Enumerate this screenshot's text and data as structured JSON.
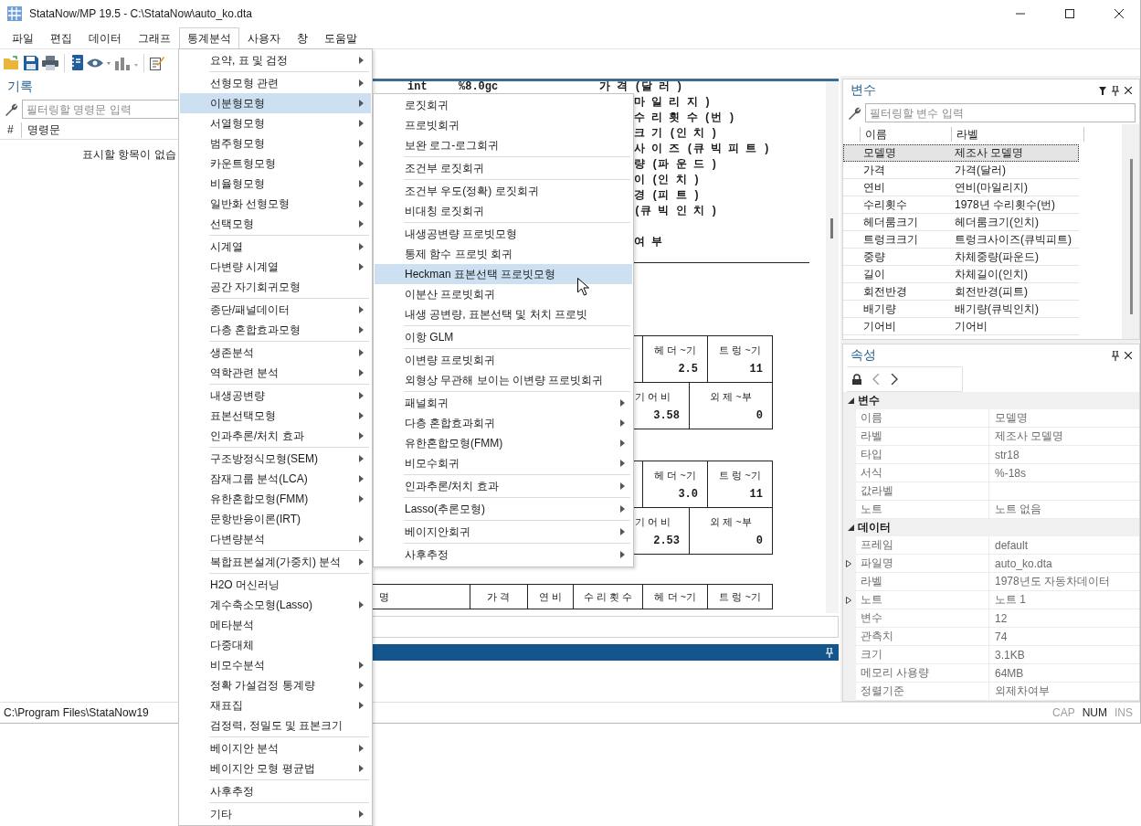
{
  "window": {
    "title": "StataNow/MP 19.5 - C:\\StataNow\\auto_ko.dta"
  },
  "menubar": [
    {
      "label": "파일",
      "selected": false
    },
    {
      "label": "편집",
      "selected": false
    },
    {
      "label": "데이터",
      "selected": false
    },
    {
      "label": "그래프",
      "selected": false
    },
    {
      "label": "통계분석",
      "selected": true
    },
    {
      "label": "사용자",
      "selected": false
    },
    {
      "label": "창",
      "selected": false
    },
    {
      "label": "도움말",
      "selected": false
    }
  ],
  "history": {
    "title": "기록",
    "filter": {
      "placeholder": "필터링할 명령문 입력"
    },
    "columns": [
      "#",
      "명령문"
    ],
    "empty_text": "표시할 항목이 없습"
  },
  "results": {
    "describe_first": [
      "int",
      "%8.0gc",
      "가 격 (달 러 )"
    ],
    "describe_lines": [
      "마 일 리 지 )",
      "수 리 횟 수 (번 )",
      "크 기 (인 치 )",
      "사 이 즈 (큐 빅 피 트 )",
      "량 (파 운 드 )",
      "이 (인 치 )",
      "경 (피 트 )",
      "(큐 빅 인 치 )",
      "여 부"
    ],
    "tables": [
      {
        "rows": [
          [
            {
              "header": "헤 더 ~기",
              "value": "2.5"
            },
            {
              "header": "트 렁 ~기",
              "value": "11"
            }
          ],
          [
            {
              "header": "기 어 비",
              "value": "3.58"
            },
            {
              "header": "외 제 ~부",
              "value": "0"
            }
          ]
        ]
      },
      {
        "rows": [
          [
            {
              "header": "헤 더 ~기",
              "value": "3.0"
            },
            {
              "header": "트 렁 ~기",
              "value": "11"
            }
          ],
          [
            {
              "header": "기 어 비",
              "value": "2.53"
            },
            {
              "header": "외 제 ~부",
              "value": "0"
            }
          ]
        ]
      }
    ],
    "list_header": [
      "명",
      "가 격",
      "연 비",
      "수 리 횟 수",
      "헤 더 ~기",
      "트 렁 ~기"
    ]
  },
  "variables": {
    "title": "변수",
    "filter": {
      "placeholder": "필터링할 변수 입력"
    },
    "columns": [
      "이름",
      "라벨"
    ],
    "rows": [
      {
        "name": "모델명",
        "label": "제조사 모델명",
        "selected": true
      },
      {
        "name": "가격",
        "label": "가격(달러)",
        "selected": false
      },
      {
        "name": "연비",
        "label": "연비(마일리지)",
        "selected": false
      },
      {
        "name": "수리횟수",
        "label": "1978년 수리횟수(번)",
        "selected": false
      },
      {
        "name": "헤더룸크기",
        "label": "헤더룸크기(인치)",
        "selected": false
      },
      {
        "name": "트렁크크기",
        "label": "트렁크사이즈(큐빅피트)",
        "selected": false
      },
      {
        "name": "중량",
        "label": "차체중량(파운드)",
        "selected": false
      },
      {
        "name": "길이",
        "label": "차체길이(인치)",
        "selected": false
      },
      {
        "name": "회전반경",
        "label": "회전반경(피트)",
        "selected": false
      },
      {
        "name": "배기량",
        "label": "배기량(큐빅인치)",
        "selected": false
      },
      {
        "name": "기어비",
        "label": "기어비",
        "selected": false
      }
    ]
  },
  "properties": {
    "title": "속성",
    "groups": [
      {
        "name": "변수",
        "expanded": true,
        "rows": [
          {
            "key": "이름",
            "value": "모델명",
            "expandable": false
          },
          {
            "key": "라벨",
            "value": "제조사 모델명",
            "expandable": false
          },
          {
            "key": "타입",
            "value": "str18",
            "expandable": false
          },
          {
            "key": "서식",
            "value": "%-18s",
            "expandable": false
          },
          {
            "key": "값라벨",
            "expandable": false
          },
          {
            "key": "노트",
            "value": "노트 없음",
            "expandable": false
          }
        ]
      },
      {
        "name": "데이터",
        "expanded": true,
        "rows": [
          {
            "key": "프레임",
            "value": "default",
            "expandable": false
          },
          {
            "key": "파일명",
            "value": "auto_ko.dta",
            "expandable": true
          },
          {
            "key": "라벨",
            "value": "1978년도 자동차데이터",
            "expandable": false
          },
          {
            "key": "노트",
            "value": "노트 1",
            "expandable": true
          },
          {
            "key": "변수",
            "value": "12",
            "expandable": false
          },
          {
            "key": "관측치",
            "value": "74",
            "expandable": false
          },
          {
            "key": "크기",
            "value": "3.1KB",
            "expandable": false
          },
          {
            "key": "메모리 사용량",
            "value": "64MB",
            "expandable": false
          },
          {
            "key": "정렬기준",
            "value": "외제차여부",
            "expandable": false
          }
        ]
      }
    ]
  },
  "status_bar": {
    "path": "C:\\Program Files\\StataNow19",
    "indicators": [
      {
        "label": "CAP",
        "on": false
      },
      {
        "label": "NUM",
        "on": true
      },
      {
        "label": "INS",
        "on": false
      }
    ]
  },
  "stats_menu": {
    "groups": [
      [
        {
          "label": "요약, 표 및 검정",
          "has_submenu": true,
          "selected": false
        }
      ],
      [
        {
          "label": "선형모형 관련",
          "has_submenu": true,
          "selected": false
        },
        {
          "label": "이분형모형",
          "has_submenu": true,
          "selected": true
        },
        {
          "label": "서열형모형",
          "has_submenu": true,
          "selected": false
        },
        {
          "label": "범주형모형",
          "has_submenu": true,
          "selected": false
        },
        {
          "label": "카운트형모형",
          "has_submenu": true,
          "selected": false
        },
        {
          "label": "비율형모형",
          "has_submenu": true,
          "selected": false
        },
        {
          "label": "일반화 선형모형",
          "has_submenu": true,
          "selected": false
        },
        {
          "label": "선택모형",
          "has_submenu": true,
          "selected": false
        }
      ],
      [
        {
          "label": "시계열",
          "has_submenu": true,
          "selected": false
        },
        {
          "label": "다변량 시계열",
          "has_submenu": true,
          "selected": false
        },
        {
          "label": "공간 자기회귀모형",
          "has_submenu": false,
          "selected": false
        }
      ],
      [
        {
          "label": "종단/패널데이터",
          "has_submenu": true,
          "selected": false
        },
        {
          "label": "다층 혼합효과모형",
          "has_submenu": true,
          "selected": false
        }
      ],
      [
        {
          "label": "생존분석",
          "has_submenu": true,
          "selected": false
        },
        {
          "label": "역학관련 분석",
          "has_submenu": true,
          "selected": false
        }
      ],
      [
        {
          "label": "내생공변량",
          "has_submenu": true,
          "selected": false
        },
        {
          "label": "표본선택모형",
          "has_submenu": true,
          "selected": false
        },
        {
          "label": "인과추론/처치 효과",
          "has_submenu": true,
          "selected": false
        }
      ],
      [
        {
          "label": "구조방정식모형(SEM)",
          "has_submenu": true,
          "selected": false
        },
        {
          "label": "잠재그룹 분석(LCA)",
          "has_submenu": true,
          "selected": false
        },
        {
          "label": "유한혼합모형(FMM)",
          "has_submenu": true,
          "selected": false
        },
        {
          "label": "문항반응이론(IRT)",
          "has_submenu": false,
          "selected": false
        },
        {
          "label": "다변량분석",
          "has_submenu": true,
          "selected": false
        }
      ],
      [
        {
          "label": "복합표본설계(가중치) 분석",
          "has_submenu": true,
          "selected": false
        }
      ],
      [
        {
          "label": "H2O 머신러닝",
          "has_submenu": false,
          "selected": false
        },
        {
          "label": "계수축소모형(Lasso)",
          "has_submenu": true,
          "selected": false
        },
        {
          "label": "메타분석",
          "has_submenu": false,
          "selected": false
        },
        {
          "label": "다중대체",
          "has_submenu": false,
          "selected": false
        },
        {
          "label": "비모수분석",
          "has_submenu": true,
          "selected": false
        },
        {
          "label": "정확 가설검정 통계량",
          "has_submenu": true,
          "selected": false
        },
        {
          "label": "재표집",
          "has_submenu": true,
          "selected": false
        },
        {
          "label": "검정력, 정밀도 및 표본크기",
          "has_submenu": false,
          "selected": false
        }
      ],
      [
        {
          "label": "베이지안 분석",
          "has_submenu": true,
          "selected": false
        },
        {
          "label": "베이지안 모형 평균법",
          "has_submenu": true,
          "selected": false
        }
      ],
      [
        {
          "label": "사후추정",
          "has_submenu": false,
          "selected": false
        }
      ],
      [
        {
          "label": "기타",
          "has_submenu": true,
          "selected": false
        }
      ]
    ]
  },
  "binary_menu": {
    "groups": [
      [
        {
          "label": "로짓회귀",
          "has_submenu": false,
          "selected": false
        },
        {
          "label": "프로빗회귀",
          "has_submenu": false,
          "selected": false
        },
        {
          "label": "보완 로그-로그회귀",
          "has_submenu": false,
          "selected": false
        }
      ],
      [
        {
          "label": "조건부 로짓회귀",
          "has_submenu": false,
          "selected": false
        }
      ],
      [
        {
          "label": "조건부 우도(정확) 로짓회귀",
          "has_submenu": false,
          "selected": false
        },
        {
          "label": "비대칭 로짓회귀",
          "has_submenu": false,
          "selected": false
        }
      ],
      [
        {
          "label": "내생공변량 프로빗모형",
          "has_submenu": false,
          "selected": false
        },
        {
          "label": "통제 함수 프로빗 회귀",
          "has_submenu": false,
          "selected": false
        },
        {
          "label": "Heckman 표본선택 프로빗모형",
          "has_submenu": false,
          "selected": true
        },
        {
          "label": "이분산 프로빗회귀",
          "has_submenu": false,
          "selected": false
        },
        {
          "label": "내생 공변량, 표본선택 및 처치 프로빗",
          "has_submenu": false,
          "selected": false
        }
      ],
      [
        {
          "label": "이항 GLM",
          "has_submenu": false,
          "selected": false
        }
      ],
      [
        {
          "label": "이변량 프로빗회귀",
          "has_submenu": false,
          "selected": false
        },
        {
          "label": "외형상 무관해 보이는 이변량 프로빗회귀",
          "has_submenu": false,
          "selected": false
        }
      ],
      [
        {
          "label": "패널회귀",
          "has_submenu": true,
          "selected": false
        },
        {
          "label": "다층 혼합효과회귀",
          "has_submenu": true,
          "selected": false
        },
        {
          "label": "유한혼합모형(FMM)",
          "has_submenu": true,
          "selected": false
        },
        {
          "label": "비모수회귀",
          "has_submenu": true,
          "selected": false
        }
      ],
      [
        {
          "label": "인과추론/처치 효과",
          "has_submenu": true,
          "selected": false
        }
      ],
      [
        {
          "label": "Lasso(추론모형)",
          "has_submenu": true,
          "selected": false
        }
      ],
      [
        {
          "label": "베이지안회귀",
          "has_submenu": true,
          "selected": false
        }
      ],
      [
        {
          "label": "사후추정",
          "has_submenu": true,
          "selected": false
        }
      ]
    ]
  }
}
